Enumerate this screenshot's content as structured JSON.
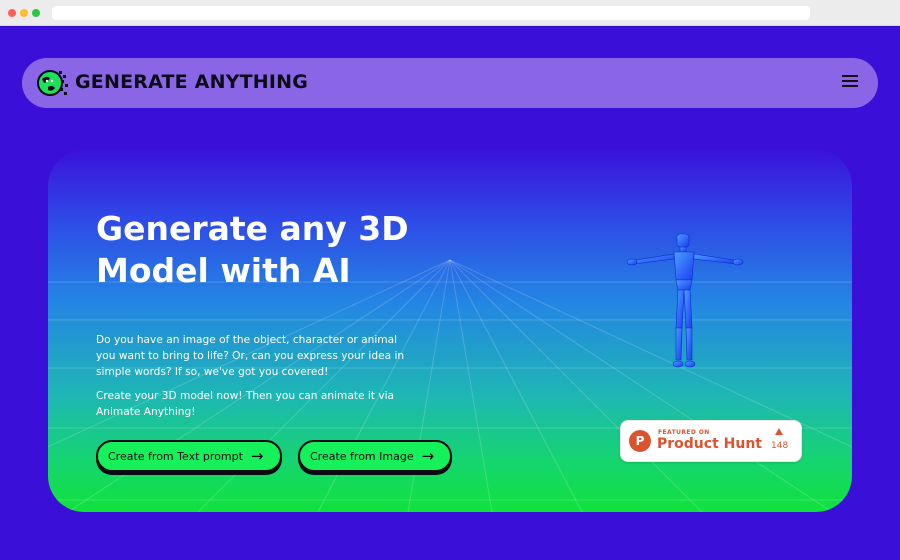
{
  "brand": {
    "name": "GENERATE ANYTHING"
  },
  "nav": {
    "menu_icon": "hamburger-menu-icon"
  },
  "hero": {
    "headline": "Generate any 3D Model with AI",
    "paragraph1": "Do you have an image of the object, character or animal you want to bring to life? Or, can you express your idea in simple words? If so, we've got you covered!",
    "paragraph2": "Create your 3D model now! Then you can animate it via Animate Anything!",
    "cta_text": "Create from Text prompt",
    "cta_image": "Create from Image",
    "cta_arrow": "→"
  },
  "product_hunt": {
    "featured": "FEATURED ON",
    "name": "Product Hunt",
    "logo_letter": "P",
    "count": "148"
  },
  "colors": {
    "page_bg": "#3a0fd8",
    "nav_bg": "#8a66e6",
    "cta_bg": "#16f05a",
    "ph_accent": "#da552f"
  }
}
